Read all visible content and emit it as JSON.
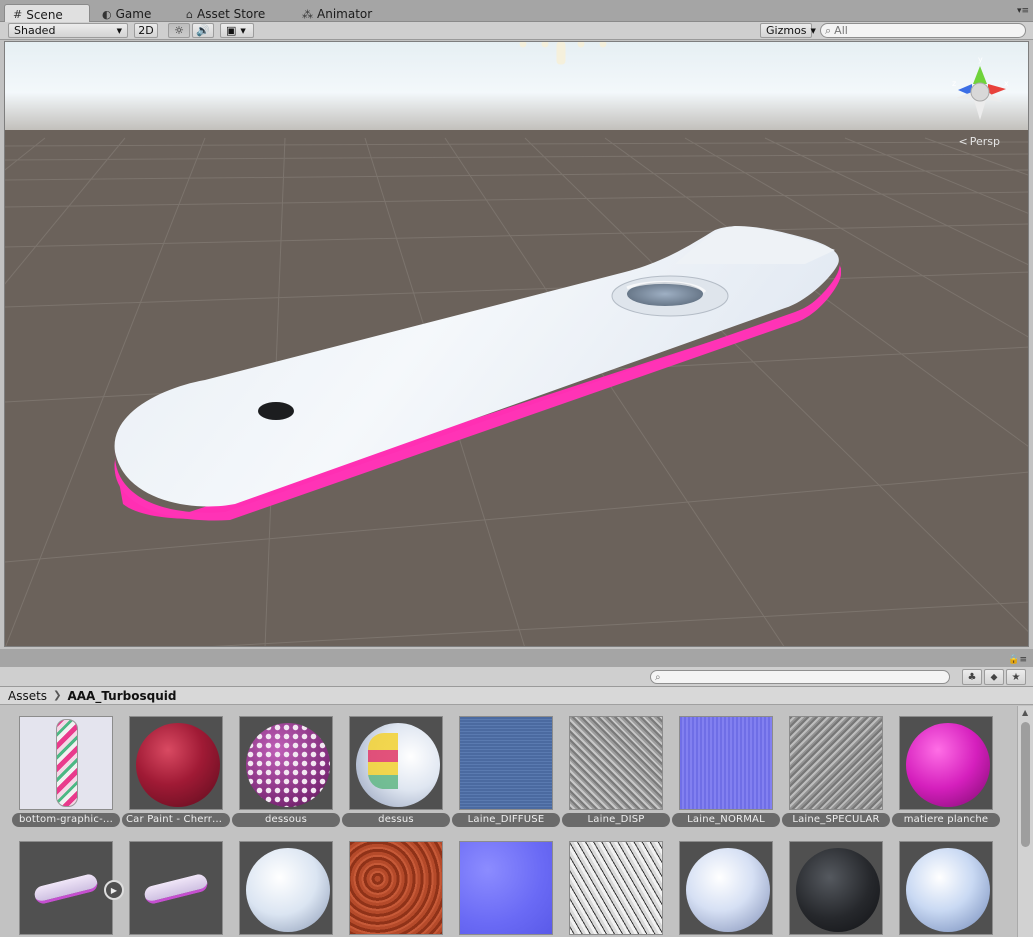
{
  "tabs": [
    {
      "label": "Scene",
      "icon": "grid-icon",
      "active": true
    },
    {
      "label": "Game",
      "icon": "pacman-icon",
      "active": false
    },
    {
      "label": "Asset Store",
      "icon": "store-icon",
      "active": false
    },
    {
      "label": "Animator",
      "icon": "animator-icon",
      "active": false
    }
  ],
  "toolbar": {
    "shading_mode": "Shaded",
    "mode_2d": "2D",
    "gizmos_label": "Gizmos",
    "search_placeholder": "All"
  },
  "scene": {
    "projection_label": "Persp",
    "gizmo_axes": {
      "x": "x",
      "y": "y",
      "z": "z"
    },
    "colors": {
      "sky_top": "#e9f2f6",
      "ground": "#6b625b",
      "board_top": "#eef3f8",
      "board_edge": "#ff33b6"
    }
  },
  "project": {
    "breadcrumb_root": "Assets",
    "breadcrumb_current": "AAA_Turbosquid",
    "search_placeholder": "",
    "assets_row1": [
      {
        "label": "bottom-graphic-...",
        "kind": "texture-graphic"
      },
      {
        "label": "Car Paint - Cherry...",
        "kind": "sphere-cherry"
      },
      {
        "label": "dessous",
        "kind": "sphere-dots"
      },
      {
        "label": "dessus",
        "kind": "sphere-hover"
      },
      {
        "label": "Laine_DIFFUSE",
        "kind": "tex-denim"
      },
      {
        "label": "Laine_DISP",
        "kind": "tex-gray"
      },
      {
        "label": "Laine_NORMAL",
        "kind": "tex-normal"
      },
      {
        "label": "Laine_SPECULAR",
        "kind": "tex-gray"
      },
      {
        "label": "matiere planche",
        "kind": "sphere-magenta"
      }
    ],
    "assets_row2": [
      {
        "kind": "model-board"
      },
      {
        "kind": "model-board"
      },
      {
        "kind": "sphere-snow"
      },
      {
        "kind": "tex-rust"
      },
      {
        "kind": "tex-bluenormal"
      },
      {
        "kind": "tex-bw"
      },
      {
        "kind": "sphere-paleblue"
      },
      {
        "kind": "sphere-dark"
      },
      {
        "kind": "sphere-paleblue"
      }
    ]
  }
}
